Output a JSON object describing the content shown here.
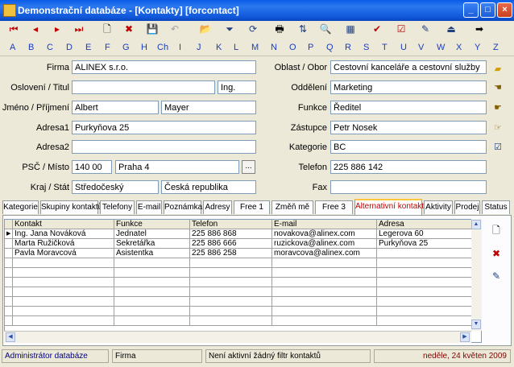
{
  "window": {
    "title": "Demonstrační databáze - [Kontakty] [forcontact]",
    "min": "_",
    "max": "□",
    "close": "×"
  },
  "toolbar": {
    "first": "⏮",
    "prev": "◂",
    "next": "▸",
    "last": "⏭",
    "new": "🗋",
    "delete": "✖",
    "save": "💾",
    "undo": "↶",
    "open": "📂",
    "filter": "⏷",
    "refresh": "⟳",
    "print": "🖶",
    "sort": "⇅",
    "find": "🔍",
    "table": "▦",
    "check": "✔",
    "checkbox": "☑",
    "edit": "✎",
    "exit": "⏏",
    "forward": "➡"
  },
  "alphabet": [
    "A",
    "B",
    "C",
    "D",
    "E",
    "F",
    "G",
    "H",
    "Ch",
    "I",
    "J",
    "K",
    "L",
    "M",
    "N",
    "O",
    "P",
    "Q",
    "R",
    "S",
    "T",
    "U",
    "V",
    "W",
    "X",
    "Y",
    "Z"
  ],
  "form": {
    "firma_label": "Firma",
    "firma": "ALINEX s.r.o.",
    "osloveni_label": "Oslovení / Titul",
    "osloveni": "",
    "titul": "Ing.",
    "jmeno_label": "Jméno / Příjmení",
    "jmeno": "Albert",
    "prijmeni": "Mayer",
    "adresa1_label": "Adresa1",
    "adresa1": "Purkyňova 25",
    "adresa2_label": "Adresa2",
    "adresa2": "",
    "psc_label": "PSČ / Místo",
    "psc": "140 00",
    "misto": "Praha 4",
    "dots": "...",
    "kraj_label": "Kraj / Stát",
    "kraj": "Středočeský",
    "stat": "Česká republika",
    "oblast_label": "Oblast / Obor",
    "oblast": "Cestovní kanceláře a cestovní služby",
    "oddeleni_label": "Oddělení",
    "oddeleni": "Marketing",
    "funkce_label": "Funkce",
    "funkce": "Ředitel",
    "zastupce_label": "Zástupce",
    "zastupce": "Petr Nosek",
    "kategorie_label": "Kategorie",
    "kategorie": "BC",
    "telefon_label": "Telefon",
    "telefon": "225 886 142",
    "fax_label": "Fax",
    "fax": ""
  },
  "tabs": [
    "Kategorie",
    "Skupiny kontaktů",
    "Telefony",
    "E-mail",
    "Poznámka",
    "Adresy",
    "Free 1",
    "Změň mě",
    "Free 3",
    "Alternativní kontakty",
    "Aktivity",
    "Prodej",
    "Status"
  ],
  "grid": {
    "headers": [
      "Kontakt",
      "Funkce",
      "Telefon",
      "E-mail",
      "Adresa"
    ],
    "rows": [
      [
        "Ing. Jana Nováková",
        "Jednatel",
        "225 886 868",
        "novakova@alinex.com",
        "Legerova 60"
      ],
      [
        "Marta Ružičková",
        "Sekretářka",
        "225 886 666",
        "ruzickova@alinex.com",
        "Purkyňova 25"
      ],
      [
        "Pavla Moravcová",
        "Asistentka",
        "225 886 258",
        "moravcova@alinex.com",
        ""
      ]
    ]
  },
  "status": {
    "user": "Administrátor databáze",
    "form": "Firma",
    "filter": "Není aktivní žádný filtr kontaktů",
    "date": "neděle, 24 květen 2009"
  }
}
